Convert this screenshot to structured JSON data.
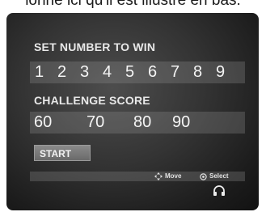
{
  "caption": "ionne ici qu'il est illustré en bas.",
  "set_number": {
    "label": "SET NUMBER TO WIN",
    "numbers": [
      "1",
      "2",
      "3",
      "4",
      "5",
      "6",
      "7",
      "8",
      "9"
    ]
  },
  "challenge_score": {
    "label": "CHALLENGE SCORE",
    "scores": [
      "60",
      "70",
      "80",
      "90"
    ]
  },
  "start_button": "START",
  "hints": {
    "move": "Move",
    "select": "Select"
  },
  "icons": {
    "move": "dpad-icon",
    "select": "select-button-icon",
    "headset": "headset-icon"
  },
  "colors": {
    "screen_bg": "#333333",
    "text": "#f4f4f4"
  }
}
